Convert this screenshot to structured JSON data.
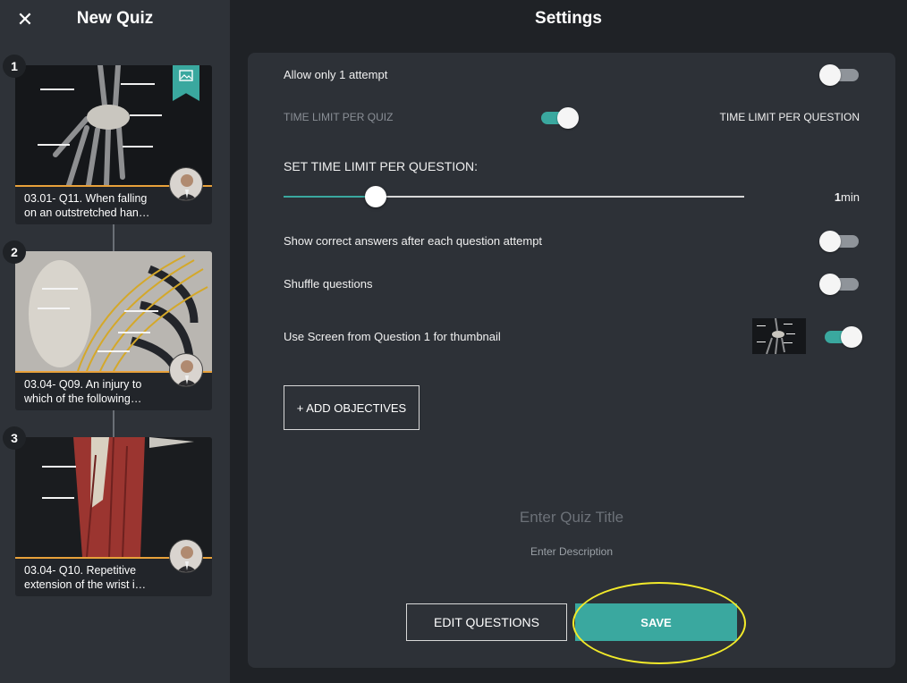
{
  "sidebar": {
    "close_icon": "close-icon",
    "title": "New Quiz",
    "questions": [
      {
        "number": "1",
        "line1": "03.01- Q11. When falling",
        "line2": "on an outstretched han…"
      },
      {
        "number": "2",
        "line1": "03.04- Q09. An injury to",
        "line2": "which of the following…"
      },
      {
        "number": "3",
        "line1": "03.04- Q10. Repetitive",
        "line2": "extension of the wrist i…"
      }
    ]
  },
  "main": {
    "title": "Settings",
    "allow_one_attempt": {
      "label": "Allow only 1 attempt",
      "on": false
    },
    "time_limit_mode": {
      "left_label": "TIME LIMIT PER QUIZ",
      "right_label": "TIME LIMIT PER QUESTION",
      "on": true
    },
    "time_limit": {
      "label": "SET TIME LIMIT PER QUESTION:",
      "value": "1",
      "unit": "min",
      "fraction": 0.2
    },
    "show_correct": {
      "label": "Show correct answers after each question attempt",
      "on": false
    },
    "shuffle": {
      "label": "Shuffle questions",
      "on": false
    },
    "use_screen": {
      "label": "Use Screen from Question 1 for thumbnail",
      "on": true
    },
    "add_objectives": "+ ADD OBJECTIVES",
    "quiz_title_placeholder": "Enter Quiz Title",
    "description_placeholder": "Enter Description",
    "edit_questions": "EDIT QUESTIONS",
    "save": "SAVE"
  },
  "colors": {
    "accent": "#3aa89f",
    "highlight": "#f2ea2a",
    "card_divider": "#e8a13a"
  }
}
